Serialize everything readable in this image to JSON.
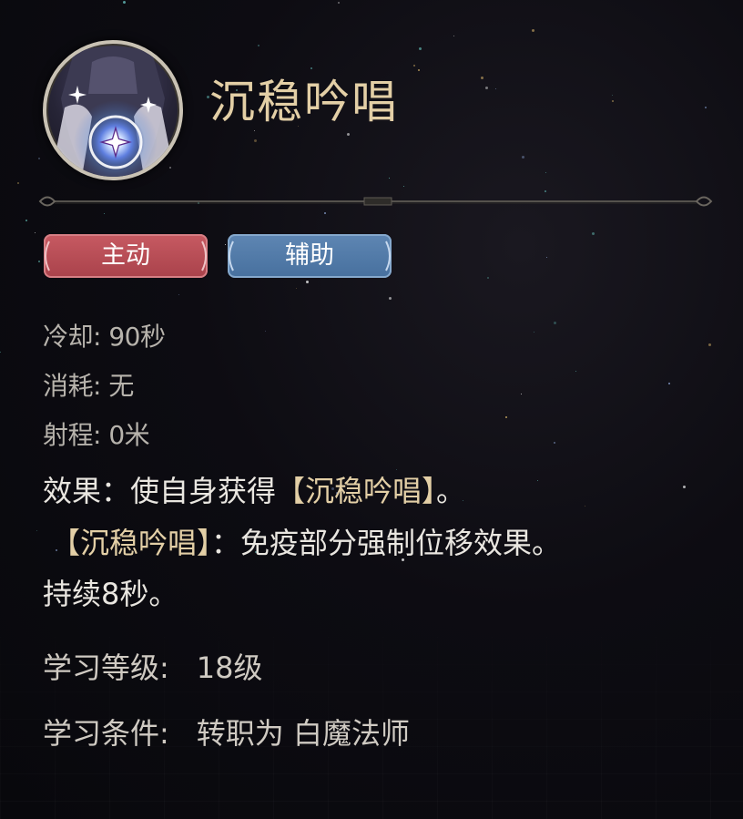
{
  "skill": {
    "name": "沉稳吟唱",
    "icon": "skill-orb-icon"
  },
  "tags": [
    {
      "label": "主动",
      "color": "#b84f57"
    },
    {
      "label": "辅助",
      "color": "#5a82ae"
    }
  ],
  "stats": {
    "cooldown": "冷却: 90秒",
    "cost": "消耗: 无",
    "range": "射程: 0米"
  },
  "description": {
    "effect_prefix": "效果：使自身获得",
    "effect_highlight": "【沉稳吟唱】",
    "effect_suffix": "。",
    "detail_highlight": "【沉稳吟唱】",
    "detail_text": "：免疫部分强制位移效果。",
    "duration": "持续8秒。"
  },
  "requirements": {
    "level_label": "学习等级:",
    "level_value": "18级",
    "condition_label": "学习条件:",
    "condition_value": "转职为 白魔法师"
  },
  "colors": {
    "title": "#e3cfa6",
    "highlight": "#e3cfa6",
    "stat_text": "#b7b3ac",
    "body_text": "#e9e6e0"
  }
}
